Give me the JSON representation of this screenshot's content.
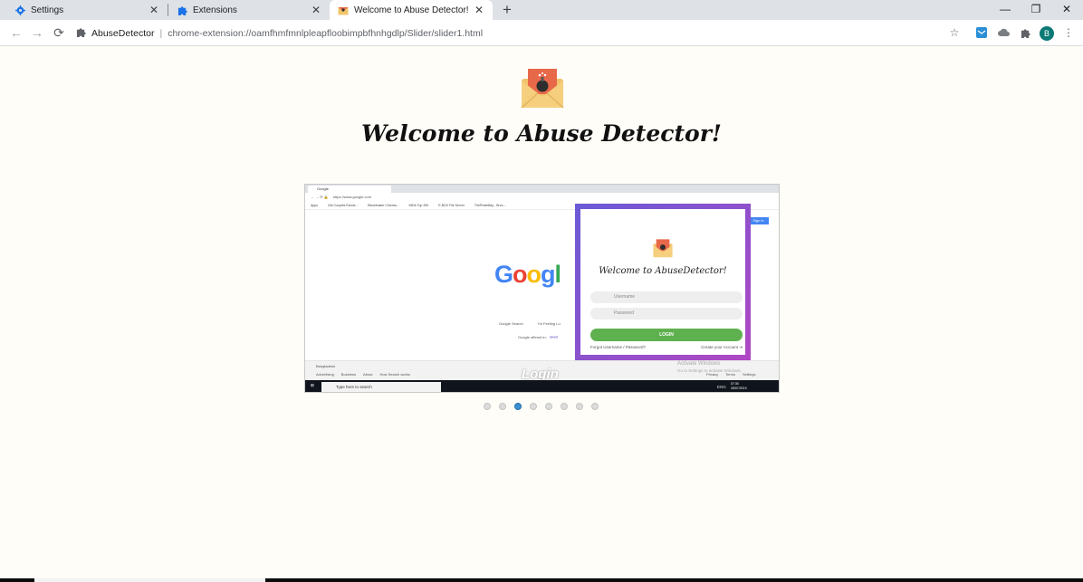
{
  "tabs": [
    {
      "label": "Settings",
      "icon": "gear-icon",
      "active": false
    },
    {
      "label": "Extensions",
      "icon": "puzzle-icon",
      "active": false
    },
    {
      "label": "Welcome to Abuse Detector!",
      "icon": "envelope-icon",
      "active": true
    }
  ],
  "toolbar": {
    "extension_name": "AbuseDetector",
    "url": "chrome-extension://oamfhmfmnlpleapfloobimpbfhnhgdlp/Slider/slider1.html",
    "avatar_letter": "B"
  },
  "page": {
    "welcome_title": "Welcome to Abuse Detector!"
  },
  "slide": {
    "tab_label": "Google",
    "url": "https://www.google.com",
    "bookmarks": [
      "Apps",
      "Get Couples Ebook...",
      "Blockbuster Cinema...",
      "IMDb Top 250",
      "E-BOX File Server",
      "ThePirateBay - Bron..."
    ],
    "google_letters": [
      "G",
      "o",
      "o",
      "g",
      "l"
    ],
    "search_buttons": [
      "Google Search",
      "I'm Feeling Lu"
    ],
    "offered_in": "Google offered in:",
    "offered_lang": "বাংলা",
    "sign_in": "Sign in",
    "country": "Bangladesh",
    "footer_links": [
      "Advertising",
      "Business",
      "About",
      "How Search works"
    ],
    "footer_right_links": [
      "Privacy",
      "Terms",
      "Settings"
    ],
    "activate_windows": "Activate Windows",
    "activate_windows_sub": "Go to Settings to activate Windows.",
    "caption": "Login",
    "taskbar_search": "Type here to search",
    "clock_time": "07:30",
    "clock_date": "28/07/2019",
    "lang": "ENG",
    "popup": {
      "title": "Welcome to AbuseDetector!",
      "username_placeholder": "Username",
      "password_placeholder": "Password",
      "login_button": "LOGIN",
      "forgot_prefix": "Forgot",
      "forgot_link": "Username / Password?",
      "create_account": "Create your Account"
    }
  },
  "carousel": {
    "dot_count": 8,
    "active_index": 2
  },
  "colors": {
    "accent_blue": "#3a8fd0",
    "login_green": "#5fb14f",
    "popup_gradient_start": "#6a5ad6",
    "popup_gradient_end": "#b048c3",
    "page_background": "#fffdf7"
  }
}
